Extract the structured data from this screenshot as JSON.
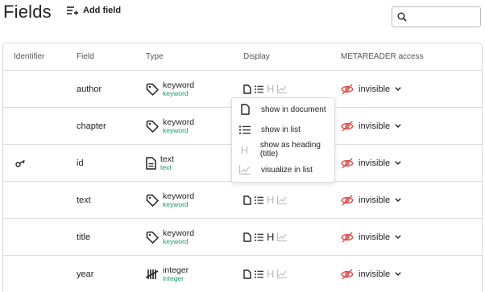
{
  "header": {
    "title": "Fields",
    "add_field_label": "Add field",
    "search_placeholder": ""
  },
  "table": {
    "columns": [
      "Identifier",
      "Field",
      "Type",
      "Display",
      "METAREADER access"
    ],
    "rows": [
      {
        "identifier_icon": "",
        "field": "author",
        "type": "keyword",
        "subtype": "keyword",
        "type_icon": "tag-icon",
        "heading_on": false,
        "access": "invisible"
      },
      {
        "identifier_icon": "",
        "field": "chapter",
        "type": "keyword",
        "subtype": "keyword",
        "type_icon": "tag-icon",
        "heading_on": false,
        "access": "invisible"
      },
      {
        "identifier_icon": "key-icon",
        "field": "id",
        "type": "text",
        "subtype": "text",
        "type_icon": "document-icon",
        "heading_on": false,
        "access": "invisible"
      },
      {
        "identifier_icon": "",
        "field": "text",
        "type": "keyword",
        "subtype": "keyword",
        "type_icon": "tag-icon",
        "heading_on": false,
        "access": "invisible"
      },
      {
        "identifier_icon": "",
        "field": "title",
        "type": "keyword",
        "subtype": "keyword",
        "type_icon": "tag-icon",
        "heading_on": true,
        "access": "invisible"
      },
      {
        "identifier_icon": "",
        "field": "year",
        "type": "integer",
        "subtype": "integer",
        "type_icon": "tally-icon",
        "heading_on": false,
        "access": "invisible"
      }
    ]
  },
  "display_menu": {
    "items": [
      {
        "label": "show in document",
        "icon": "document-icon"
      },
      {
        "label": "show in list",
        "icon": "list-icon"
      },
      {
        "label": "show as heading (title)",
        "icon": "heading-icon"
      },
      {
        "label": "visualize in list",
        "icon": "chart-icon"
      }
    ]
  },
  "colors": {
    "subtype": "#1a9a6a",
    "invisible_icon": "#d9534f",
    "inactive": "#bbbbbb"
  }
}
